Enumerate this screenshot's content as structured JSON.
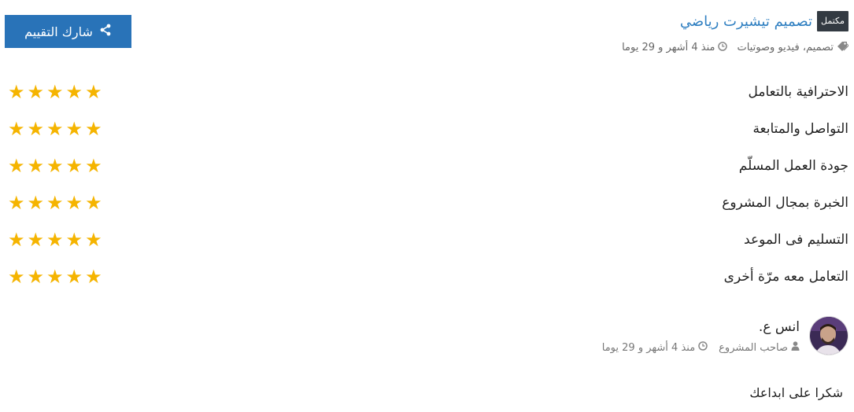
{
  "project": {
    "badge": "مكتمل",
    "title": "تصميم تيشيرت رياضي",
    "tag_icon": "tags-icon",
    "tags": "تصميم، فيديو وصوتيات",
    "time_icon": "clock-icon",
    "time": "منذ 4 أشهر و 29 يوما"
  },
  "share_button": {
    "label": "شارك التقييم",
    "icon": "share-icon"
  },
  "star_color": "#f5b400",
  "ratings": [
    {
      "label": "الاحترافية بالتعامل",
      "stars": 5
    },
    {
      "label": "التواصل والمتابعة",
      "stars": 5
    },
    {
      "label": "جودة العمل المسلّم",
      "stars": 5
    },
    {
      "label": "الخبرة بمجال المشروع",
      "stars": 5
    },
    {
      "label": "التسليم فى الموعد",
      "stars": 5
    },
    {
      "label": "التعامل معه مرّة أخرى",
      "stars": 5
    }
  ],
  "review": {
    "name": "انس ع.",
    "role_icon": "user-icon",
    "role": "صاحب المشروع",
    "time_icon": "clock-icon",
    "time": "منذ 4 أشهر و 29 يوما",
    "comment": "شكرا على ابداعك"
  }
}
